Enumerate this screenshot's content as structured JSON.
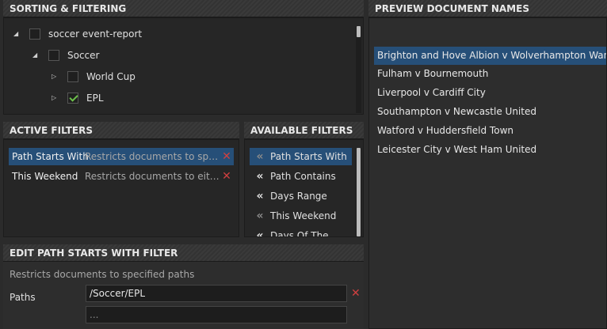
{
  "sorting": {
    "title": "SORTING & FILTERING",
    "tree": [
      {
        "label": "soccer event-report",
        "expander": "expanded",
        "checked": false
      },
      {
        "label": "Soccer",
        "expander": "expanded",
        "checked": false
      },
      {
        "label": "World Cup",
        "expander": "collapsed",
        "checked": false
      },
      {
        "label": "EPL",
        "expander": "collapsed",
        "checked": true
      }
    ]
  },
  "active_filters": {
    "title": "ACTIVE FILTERS",
    "rows": [
      {
        "name": "Path Starts With",
        "desc": "Restricts documents to speci...",
        "remove": "✕"
      },
      {
        "name": "This Weekend",
        "desc": "Restricts documents to either ...",
        "remove": "✕"
      }
    ]
  },
  "available_filters": {
    "title": "AVAILABLE FILTERS",
    "rows": [
      {
        "icon": "«",
        "label": "Path Starts With"
      },
      {
        "icon": "«",
        "label": "Path Contains"
      },
      {
        "icon": "«",
        "label": "Days Range"
      },
      {
        "icon": "«",
        "label": "This Weekend"
      },
      {
        "icon": "«",
        "label": "Days Of The ..."
      }
    ]
  },
  "edit": {
    "title": "EDIT PATH STARTS WITH FILTER",
    "description": "Restricts documents to specified paths",
    "paths_label": "Paths",
    "path_value": "/Soccer/EPL",
    "new_path_placeholder": "...",
    "remove": "✕"
  },
  "preview": {
    "title": "PREVIEW DOCUMENT NAMES",
    "items": [
      "Brighton and Hove Albion v Wolverhampton Wanderers",
      "Fulham v Bournemouth",
      "Liverpool v Cardiff City",
      "Southampton v Newcastle United",
      "Watford v Huddersfield Town",
      "Leicester City v West Ham United"
    ]
  },
  "colors": {
    "selection": "#264f78",
    "remove": "#d04040",
    "check": "#6cc04a"
  }
}
